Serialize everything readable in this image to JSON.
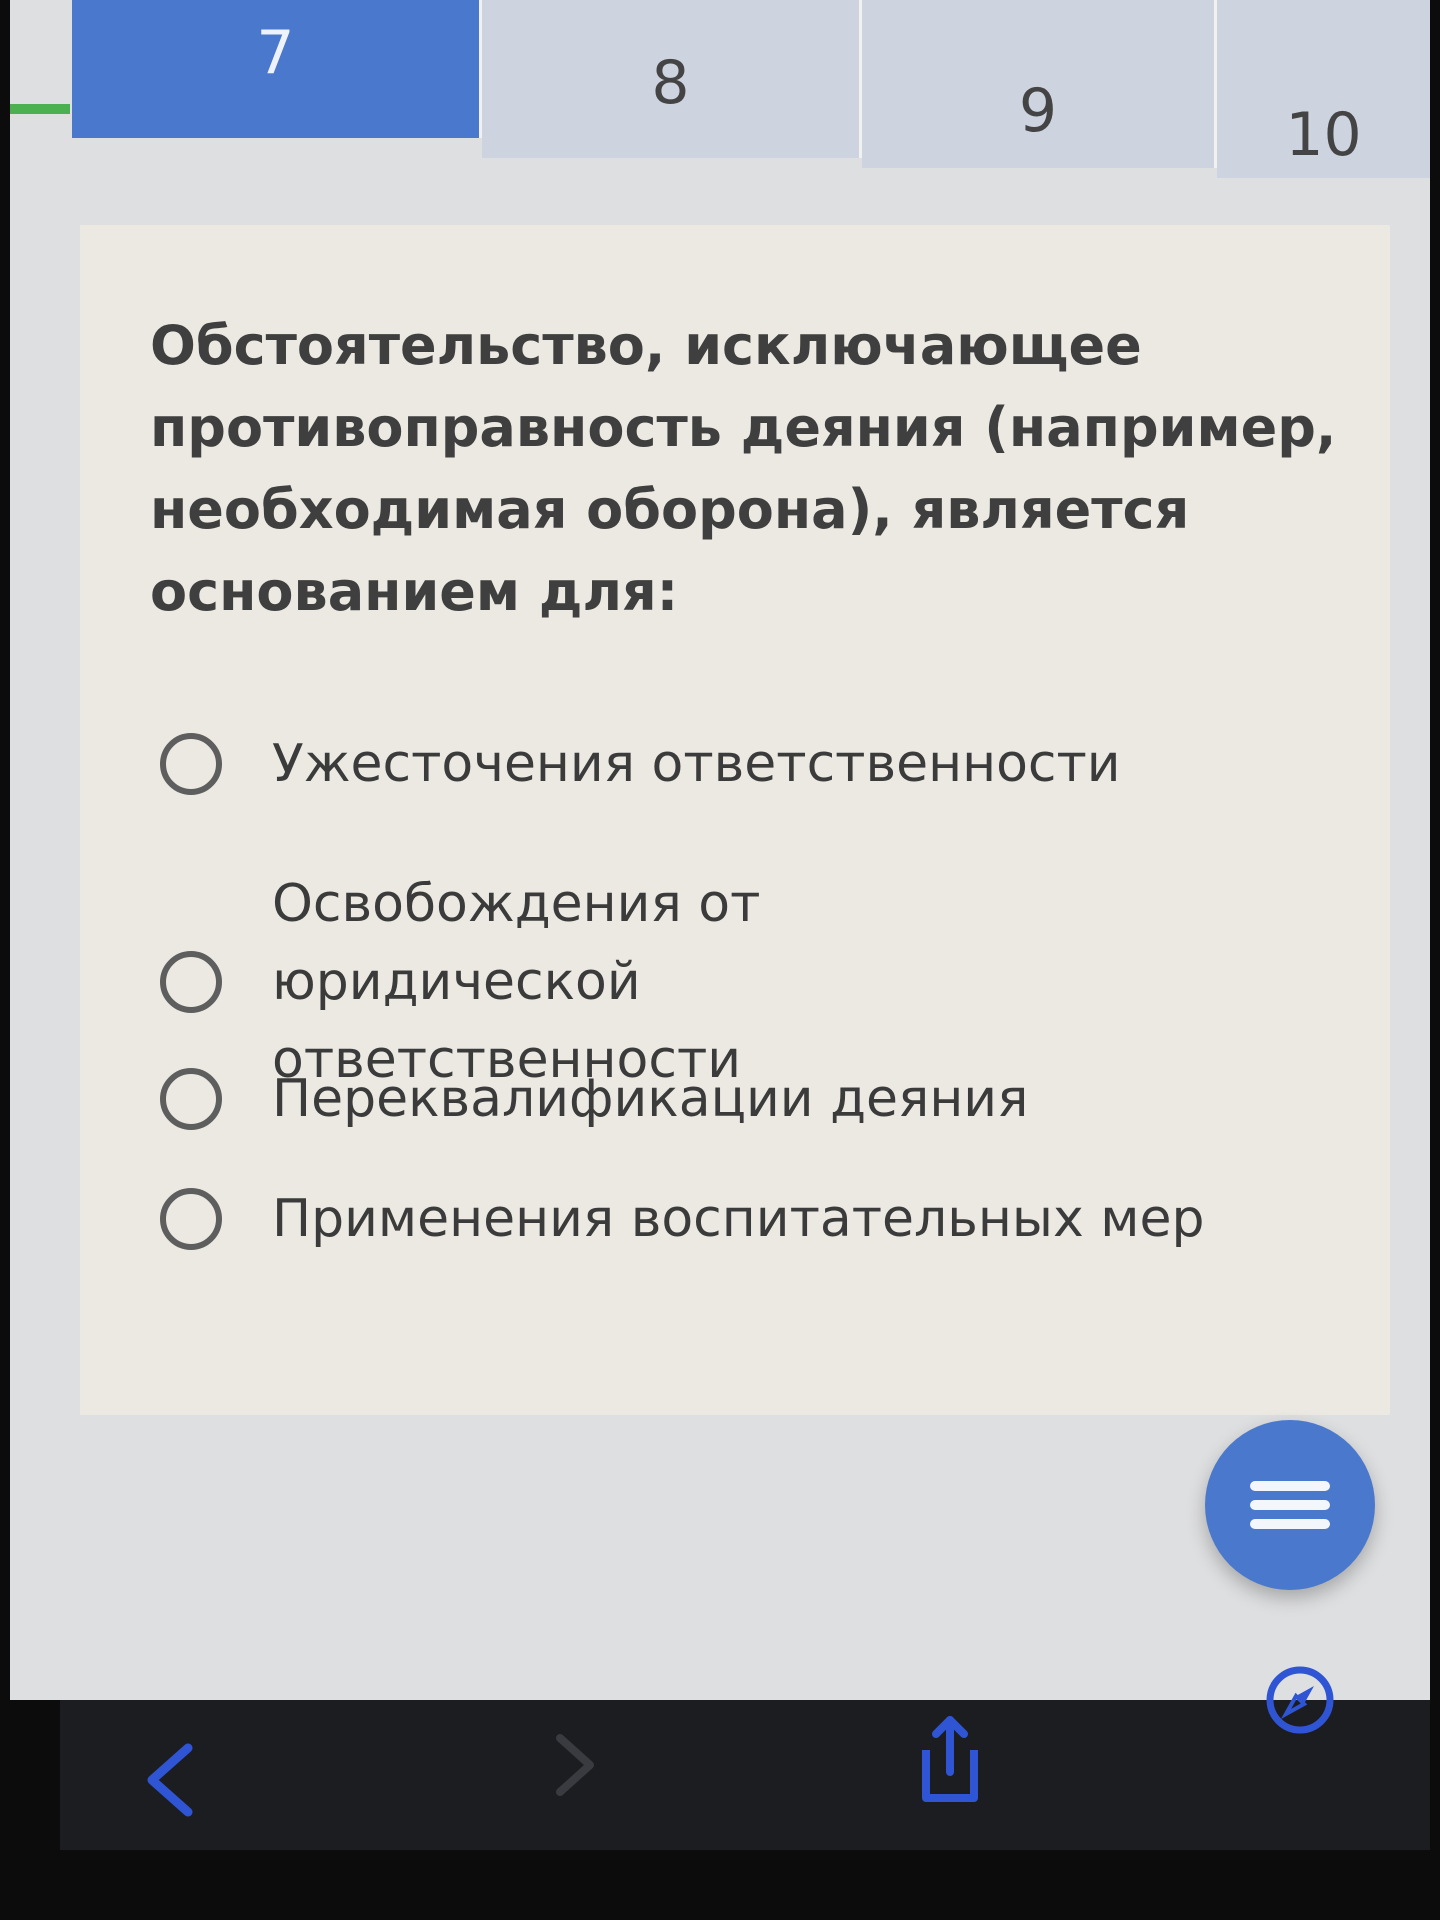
{
  "tabs": [
    {
      "label": "7",
      "active": true
    },
    {
      "label": "8",
      "active": false
    },
    {
      "label": "9",
      "active": false
    },
    {
      "label": "10",
      "active": false
    }
  ],
  "question": {
    "text": "Обстоятельство, исключающее противоправность деяния (например, необходимая оборона), является основанием для:"
  },
  "options": [
    {
      "label": "Ужесточения ответственности",
      "selected": false
    },
    {
      "label": "Освобождения от юридической ответственности",
      "selected": false
    },
    {
      "label": "Переквалификации деяния",
      "selected": false
    },
    {
      "label": "Применения воспитательных мер",
      "selected": false
    }
  ],
  "fab": {
    "icon": "menu-icon"
  },
  "toolbar": {
    "icons": [
      "back-chevron-icon",
      "forward-chevron-icon",
      "share-icon",
      "compass-icon"
    ]
  },
  "colors": {
    "accent": "#4a78cc",
    "tab_inactive": "#cdd4e0",
    "card": "#ebe9e2",
    "toolbar_icon": "#2f55d4"
  }
}
